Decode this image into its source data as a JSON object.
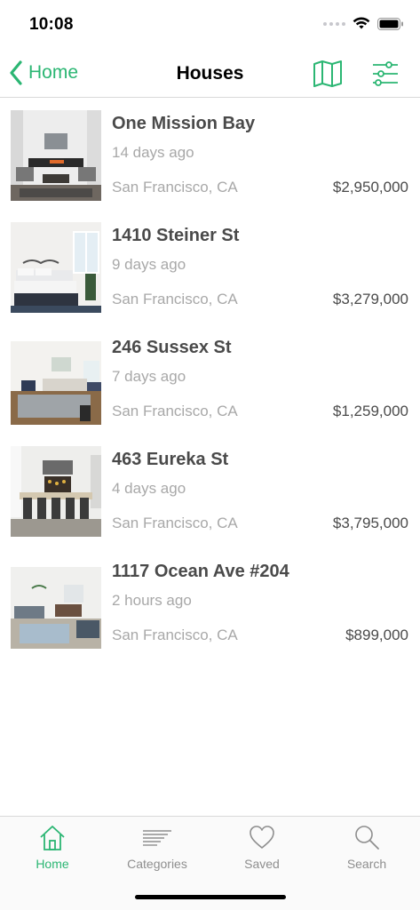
{
  "status": {
    "time": "10:08"
  },
  "nav": {
    "back_label": "Home",
    "title": "Houses",
    "map_icon": "map-icon",
    "filter_icon": "sliders-icon"
  },
  "listings": [
    {
      "title": "One Mission Bay",
      "age": "14 days ago",
      "city": "San Francisco, CA",
      "price": "$2,950,000"
    },
    {
      "title": "1410 Steiner St",
      "age": "9 days ago",
      "city": "San Francisco, CA",
      "price": "$3,279,000"
    },
    {
      "title": "246 Sussex St",
      "age": "7 days ago",
      "city": "San Francisco, CA",
      "price": "$1,259,000"
    },
    {
      "title": "463 Eureka St",
      "age": "4 days ago",
      "city": "San Francisco, CA",
      "price": "$3,795,000"
    },
    {
      "title": "1117 Ocean Ave #204",
      "age": "2 hours ago",
      "city": "San Francisco, CA",
      "price": "$899,000"
    }
  ],
  "tabs": [
    {
      "label": "Home",
      "icon": "house-icon",
      "active": true
    },
    {
      "label": "Categories",
      "icon": "list-lines-icon",
      "active": false
    },
    {
      "label": "Saved",
      "icon": "heart-icon",
      "active": false
    },
    {
      "label": "Search",
      "icon": "magnifier-icon",
      "active": false
    }
  ],
  "colors": {
    "accent": "#2bb673",
    "text_dark": "#4a4a4a",
    "text_muted": "#a8a8a8",
    "tab_inactive": "#8e8e8e"
  }
}
